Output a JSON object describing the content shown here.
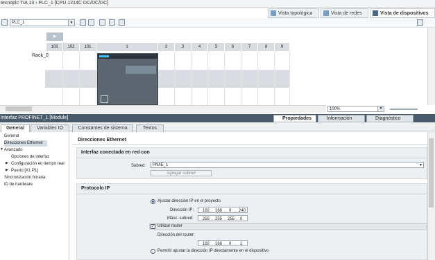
{
  "window": {
    "title": "tecnoplc TIA 13  ›  PLC_1 [CPU 1214C DC/DC/DC]"
  },
  "view_tabs": [
    {
      "label": "Vista topológica"
    },
    {
      "label": "Vista de redes"
    },
    {
      "label": "Vista de dispositivos"
    }
  ],
  "toolbar": {
    "device_select": "PLC_1"
  },
  "rack": {
    "label": "Rack_0",
    "slots": [
      "103",
      "102",
      "101",
      "1",
      "2",
      "3",
      "4",
      "5",
      "6",
      "7",
      "8",
      "9"
    ]
  },
  "zoom": {
    "value": "100%"
  },
  "inspector": {
    "title": "Interfaz PROFINET_1 [Module]",
    "panel_tabs": [
      {
        "label": "Propiedades"
      },
      {
        "label": "Información"
      },
      {
        "label": "Diagnóstico"
      }
    ],
    "tabs": [
      {
        "label": "General"
      },
      {
        "label": "Variables IO"
      },
      {
        "label": "Constantes de sistema"
      },
      {
        "label": "Textos"
      }
    ]
  },
  "nav": {
    "items": [
      {
        "label": "General"
      },
      {
        "label": "Direcciones Ethernet"
      },
      {
        "label": "Avanzado"
      },
      {
        "label": "Opciones de interfaz"
      },
      {
        "label": "Configuración en tiempo real"
      },
      {
        "label": "Puerto [X1 P1]"
      },
      {
        "label": "Sincronización horaria"
      },
      {
        "label": "ID de hardware"
      }
    ]
  },
  "content": {
    "section_title": "Direcciones Ethernet",
    "network": {
      "title": "Interfaz conectada en red con",
      "subnet_label": "Subred:",
      "subnet_value": "PN/IE_1",
      "add_subnet_button": "Agregar subred"
    },
    "ip": {
      "title": "Protocolo IP",
      "set_in_project_label": "Ajustar dirección IP en el proyecto",
      "ip_label": "Dirección IP:",
      "ip_octets": [
        "192",
        "168",
        "0",
        "240"
      ],
      "mask_label": "Másc. subred:",
      "mask_octets": [
        "255",
        "255",
        "255",
        "0"
      ],
      "use_router_label": "Utilizar router",
      "router_label": "Dirección del router:",
      "router_octets": [
        "192",
        "168",
        "0",
        "1"
      ],
      "allow_device_label": "Permitir ajustar la dirección IP directamente en el dispositivo"
    }
  },
  "colors": {
    "inspector_header": "#495a6a",
    "selection": "#d6dde4",
    "accent": "#2255aa"
  }
}
